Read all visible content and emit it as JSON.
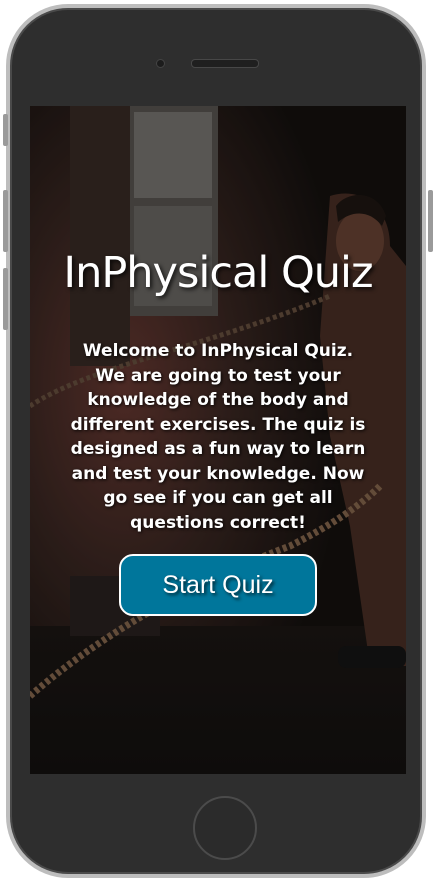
{
  "app": {
    "title": "InPhysical Quiz",
    "intro_text": "Welcome to InPhysical Quiz. We are going to test your knowledge of the body and different exercises. The quiz is designed as a fun way to learn and test your knowledge. Now go see if you can get all questions correct!",
    "start_button_label": "Start Quiz"
  },
  "colors": {
    "button_bg": "#00769b",
    "button_border": "#ffffff",
    "text": "#ffffff",
    "device_body": "#2e2e2e",
    "device_frame": "#bdbdbd"
  },
  "background": {
    "image_name": "gym-battle-ropes-photo"
  }
}
